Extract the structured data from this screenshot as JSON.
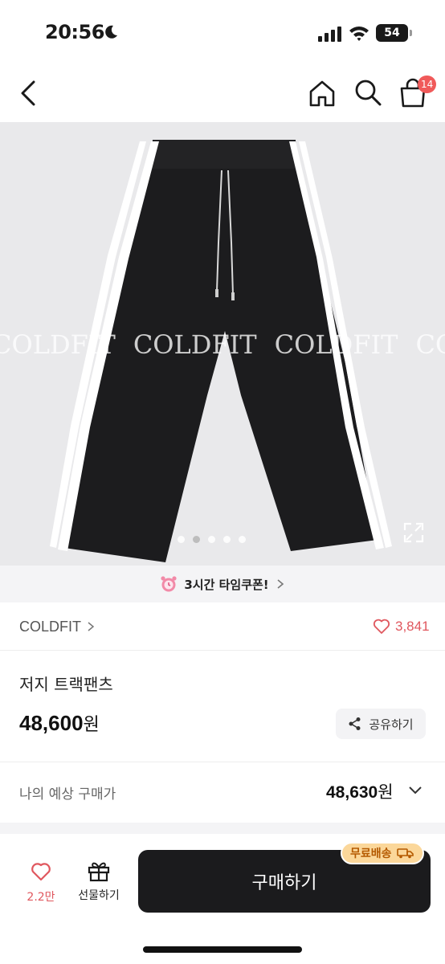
{
  "status_bar": {
    "time": "20:56",
    "battery": "54"
  },
  "header": {
    "cart_count": "14"
  },
  "product_image": {
    "watermark": [
      "COLDFIT",
      "COLDFIT",
      "COLDFIT",
      "COLDFIT"
    ],
    "carousel": {
      "total": 5,
      "active_index": 1
    }
  },
  "coupon": {
    "label": "3시간 타임쿠폰!"
  },
  "brand": {
    "name": "COLDFIT",
    "like_count": "3,841"
  },
  "product": {
    "title": "저지 트랙팬츠",
    "price": "48,600",
    "price_unit": "원",
    "share_label": "공유하기"
  },
  "expected_price": {
    "label": "나의 예상 구매가",
    "value": "48,630",
    "unit": "원"
  },
  "bottom_bar": {
    "wish_count": "2.2만",
    "gift_label": "선물하기",
    "buy_label": "구매하기",
    "free_shipping_label": "무료배송"
  },
  "colors": {
    "accent_red": "#e0575e",
    "buy_button": "#1b1b1d",
    "free_ship_bg": "#fbd79a",
    "free_ship_text": "#b55a00"
  }
}
